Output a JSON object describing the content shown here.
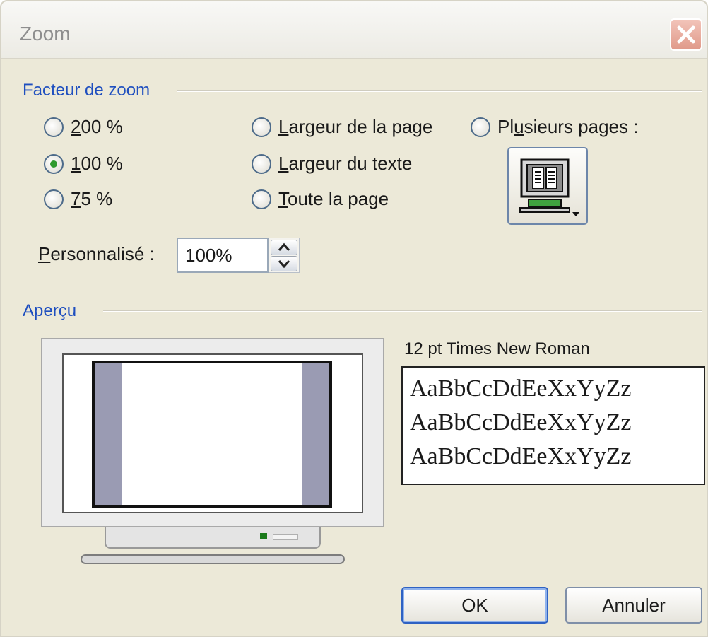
{
  "window": {
    "title": "Zoom"
  },
  "zoom_factor": {
    "label": "Facteur de zoom",
    "options": [
      {
        "label": "200 %",
        "mnemonic": "2",
        "rest": "00 %",
        "checked": false
      },
      {
        "label": "100 %",
        "mnemonic": "1",
        "rest": "00 %",
        "checked": true
      },
      {
        "label": "75 %",
        "mnemonic": "7",
        "rest": "5 %",
        "checked": false
      },
      {
        "label": "Largeur de la page",
        "mnemonic": "L",
        "rest": "argeur de la page",
        "checked": false
      },
      {
        "label": "Largeur du texte",
        "mnemonic": "L",
        "rest": "argeur du texte",
        "checked": false
      },
      {
        "label": "Toute la page",
        "mnemonic": "T",
        "rest": "oute la page",
        "checked": false
      },
      {
        "label": "Plusieurs pages :",
        "before": "Pl",
        "mnemonic": "u",
        "rest": "sieurs pages :",
        "checked": false
      }
    ],
    "pages_button_icon": "monitor-pages-icon"
  },
  "custom": {
    "label_mnemonic": "P",
    "label_rest": "ersonnalisé :",
    "value": "100%"
  },
  "preview": {
    "label": "Aperçu",
    "font_label": "12 pt Times New Roman",
    "sample_lines": [
      "AaBbCcDdEeXxYyZz",
      "AaBbCcDdEeXxYyZz",
      "AaBbCcDdEeXxYyZz"
    ]
  },
  "buttons": {
    "ok": "OK",
    "cancel": "Annuler"
  },
  "colors": {
    "group_label": "#1f4fbf",
    "dialog_bg": "#ece9d8",
    "radio_check": "#2f9a2f",
    "preview_margin": "#9a9bb3"
  }
}
